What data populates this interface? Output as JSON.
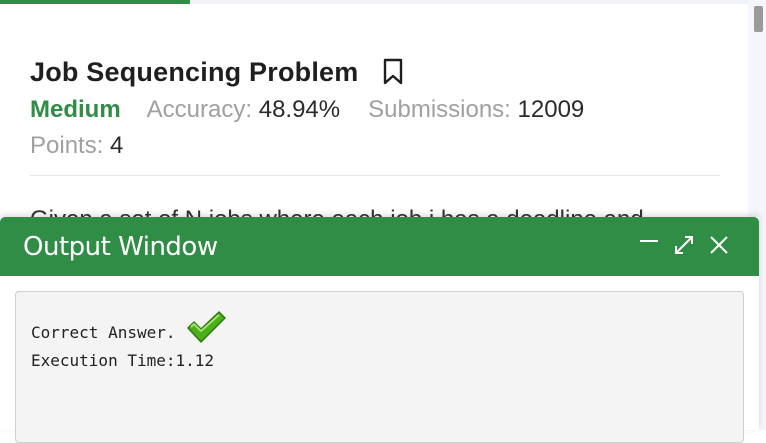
{
  "problem": {
    "title": "Job Sequencing Problem",
    "difficulty": "Medium",
    "accuracy_label": "Accuracy:",
    "accuracy_value": "48.94%",
    "submissions_label": "Submissions:",
    "submissions_value": "12009",
    "points_label": "Points:",
    "points_value": "4",
    "statement_peek": "Given a set of N jobs where each job i has a deadline and"
  },
  "output_window": {
    "title": "Output Window",
    "controls": [
      "minimize-icon",
      "expand-icon",
      "close-icon"
    ],
    "result_text": "Correct Answer.",
    "execution_text": "Execution Time:1.12"
  },
  "colors": {
    "brand_green": "#2f8d46",
    "check_green": "#4caf1a"
  }
}
